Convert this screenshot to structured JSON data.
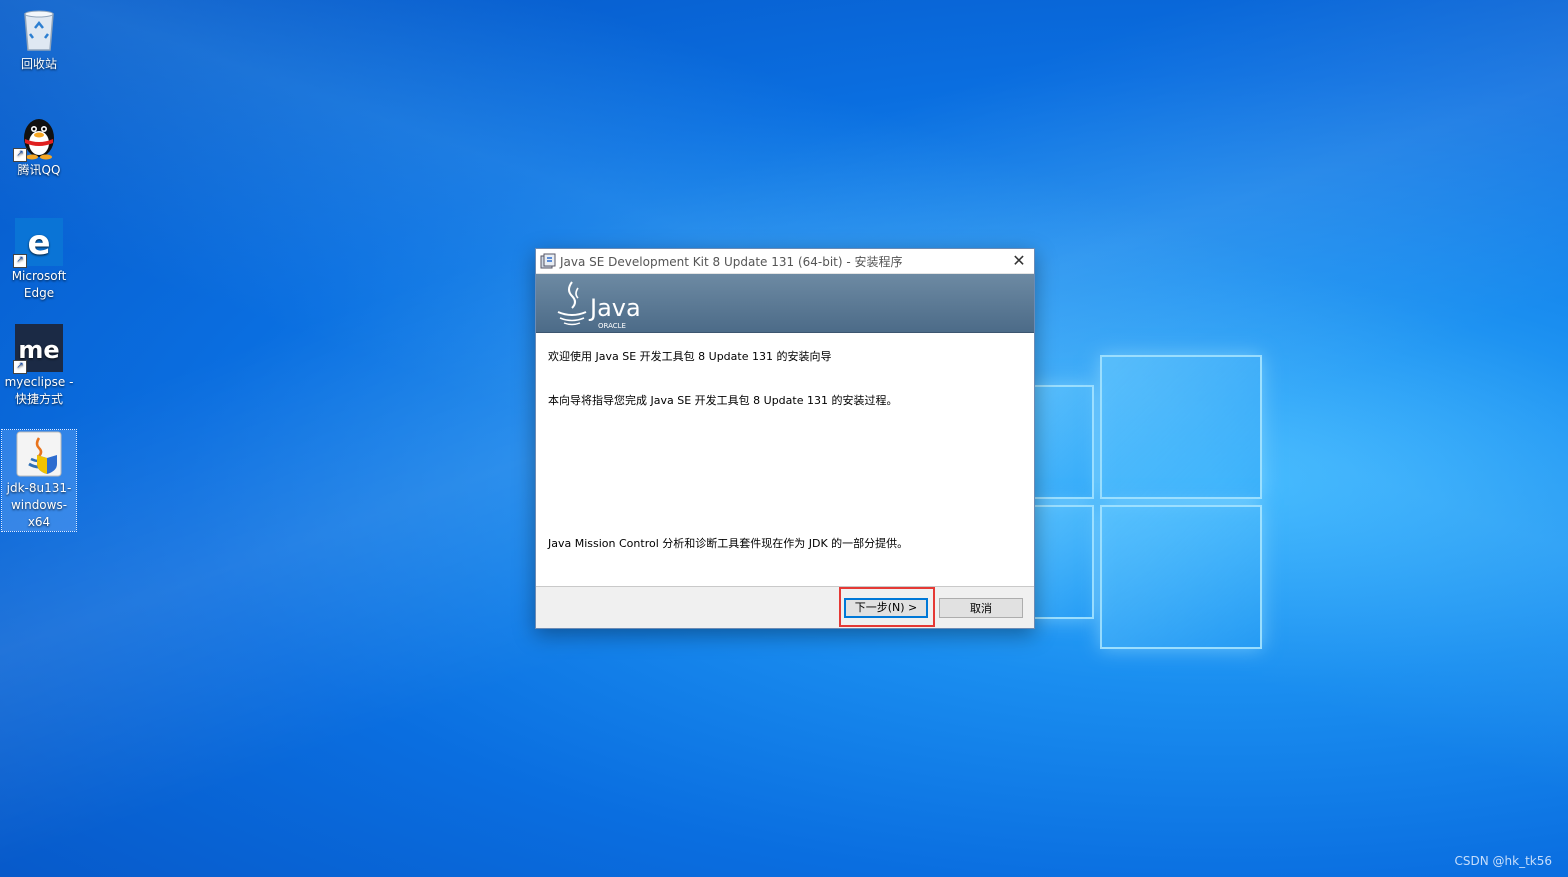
{
  "desktop": {
    "icons": [
      {
        "label": "回收站"
      },
      {
        "label": "腾讯QQ"
      },
      {
        "label": "Microsoft Edge"
      },
      {
        "label": "myeclipse - 快捷方式"
      },
      {
        "label": "jdk-8u131-windows-x64"
      }
    ],
    "watermark": "CSDN @hk_tk56"
  },
  "dialog": {
    "title": "Java SE Development Kit 8 Update 131 (64-bit) - 安装程序",
    "banner": {
      "brand": "Java",
      "sub": "ORACLE"
    },
    "line1": "欢迎使用 Java SE 开发工具包 8 Update 131 的安装向导",
    "line2": "本向导将指导您完成 Java SE 开发工具包 8 Update 131 的安装过程。",
    "line3": "Java Mission Control 分析和诊断工具套件现在作为 JDK 的一部分提供。",
    "next_label": "下一步(N) >",
    "cancel_label": "取消",
    "close_glyph": "✕"
  },
  "colors": {
    "accent": "#0078d7",
    "highlight": "#e53935",
    "banner": "#5b7a96"
  }
}
